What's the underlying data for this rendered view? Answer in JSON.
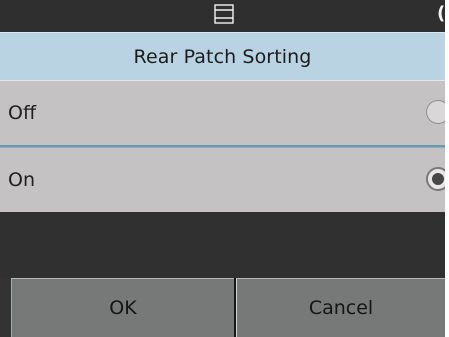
{
  "status_bar": {
    "icon": "document-feeder-icon",
    "edge_glyph": "("
  },
  "dialog": {
    "title": "Rear Patch Sorting",
    "options": [
      {
        "label": "Off",
        "selected": false
      },
      {
        "label": "On",
        "selected": true
      }
    ]
  },
  "footer": {
    "ok_label": "OK",
    "cancel_label": "Cancel"
  },
  "colors": {
    "status_background": "#2f2f2f",
    "title_background": "#b9d3e3",
    "option_background": "#c4c2c2",
    "selected_separator": "#6f95b0",
    "footer_button": "#777979"
  }
}
